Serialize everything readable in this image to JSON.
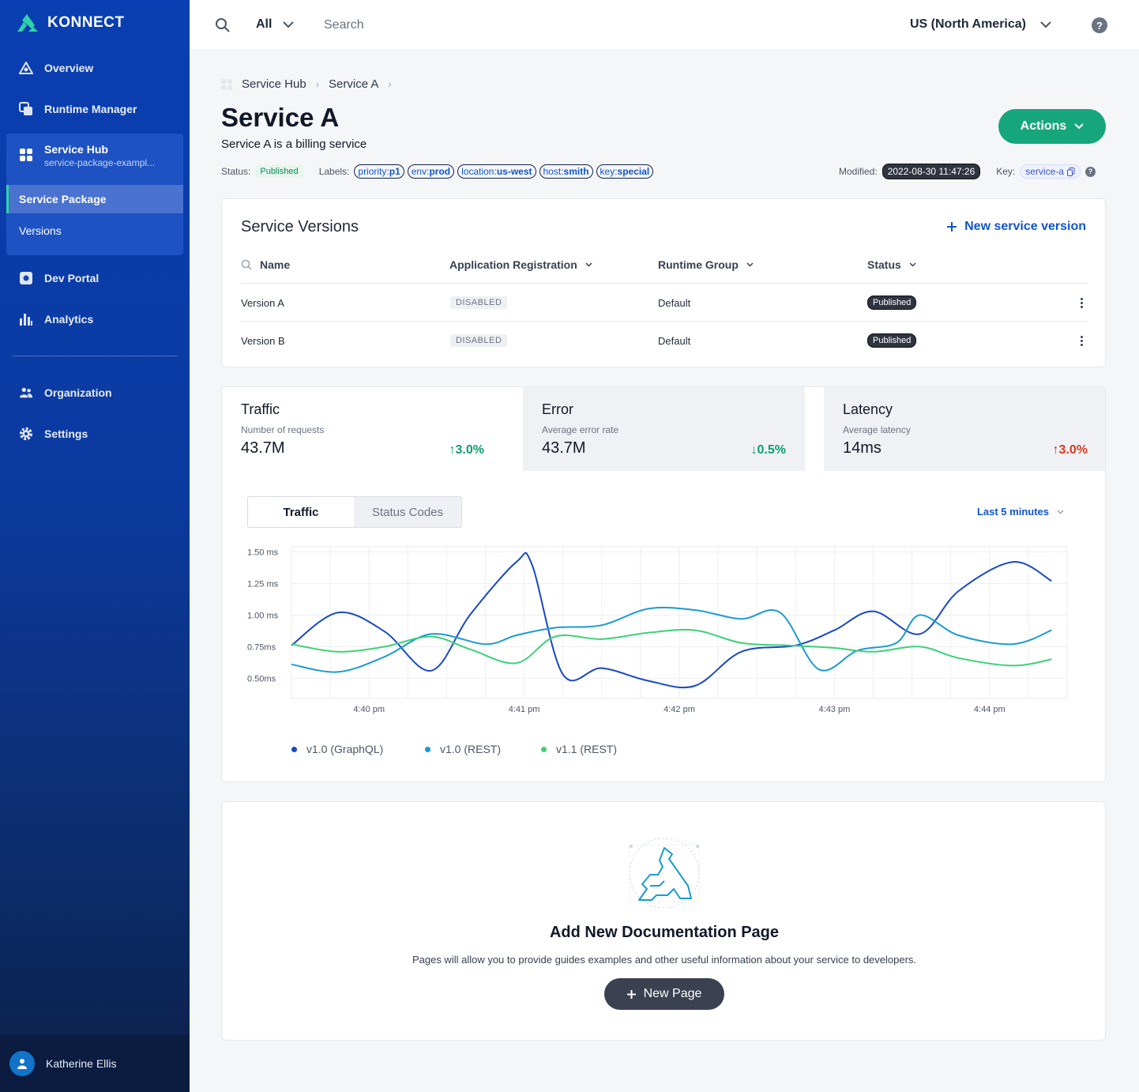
{
  "brand": {
    "name": "KONNECT"
  },
  "sidebar": {
    "items": [
      {
        "label": "Overview",
        "icon": "overview-icon"
      },
      {
        "label": "Runtime Manager",
        "icon": "runtime-manager-icon"
      },
      {
        "label": "Service Hub",
        "icon": "service-hub-icon",
        "subtitle": "service-package-exampl...",
        "children": [
          {
            "label": "Service Package",
            "active": true
          },
          {
            "label": "Versions"
          }
        ]
      },
      {
        "label": "Dev Portal",
        "icon": "dev-portal-icon"
      },
      {
        "label": "Analytics",
        "icon": "analytics-icon"
      },
      {
        "label": "Organization",
        "icon": "organization-icon"
      },
      {
        "label": "Settings",
        "icon": "settings-icon"
      }
    ],
    "user": {
      "name": "Katherine Ellis"
    }
  },
  "topbar": {
    "scope": "All",
    "search_placeholder": "Search",
    "region": "US (North America)"
  },
  "breadcrumb": [
    "Service Hub",
    "Service A"
  ],
  "service": {
    "title": "Service A",
    "description": "Service A is a billing service",
    "status_label": "Status:",
    "status": "Published",
    "labels_label": "Labels:",
    "labels": [
      {
        "key": "priority:",
        "value": "p1"
      },
      {
        "key": "env:",
        "value": "prod"
      },
      {
        "key": "location:",
        "value": "us-west"
      },
      {
        "key": "host:",
        "value": "smith"
      },
      {
        "key": "key:",
        "value": "special"
      }
    ],
    "modified_label": "Modified:",
    "modified": "2022-08-30 11:47:26",
    "key_label": "Key:",
    "key": "service-a"
  },
  "actions_label": "Actions",
  "versions": {
    "title": "Service Versions",
    "new_label": "New service version",
    "columns": [
      "Name",
      "Application Registration",
      "Runtime Group",
      "Status"
    ],
    "rows": [
      {
        "name": "Version A",
        "registration": "DISABLED",
        "runtime_group": "Default",
        "status": "Published"
      },
      {
        "name": "Version B",
        "registration": "DISABLED",
        "runtime_group": "Default",
        "status": "Published"
      }
    ]
  },
  "metrics": [
    {
      "title": "Traffic",
      "subtitle": "Number of requests",
      "value": "43.7M",
      "delta": "3.0%",
      "direction": "up",
      "color": "#0e9f6e"
    },
    {
      "title": "Error",
      "subtitle": "Average error rate",
      "value": "43.7M",
      "delta": "0.5%",
      "direction": "down",
      "color": "#0e9f6e"
    },
    {
      "title": "Latency",
      "subtitle": "Average latency",
      "value": "14ms",
      "delta": "3.0%",
      "direction": "up",
      "color": "#d9391e"
    }
  ],
  "chart_tabs": [
    "Traffic",
    "Status Codes"
  ],
  "time_range": "Last 5 minutes",
  "chart_data": {
    "type": "line",
    "ytick_labels": [
      "1.50 ms",
      "1.25 ms",
      "1.00 ms",
      "0.75ms",
      "0.50ms"
    ],
    "yticks": [
      1.5,
      1.25,
      1.0,
      0.75,
      0.5
    ],
    "ylim": [
      0.34,
      1.54
    ],
    "xticks": [
      "4:40 pm",
      "4:41 pm",
      "4:42 pm",
      "4:43 pm",
      "4:44 pm"
    ],
    "xtick_positions": [
      1,
      3,
      5,
      7,
      9
    ],
    "xlim": [
      0,
      10
    ],
    "grid": true,
    "legend_position": "bottom-left",
    "series": [
      {
        "name": "v1.0 (GraphQL)",
        "color": "#1a48c4",
        "x": [
          0,
          0.6,
          1.2,
          1.8,
          2.3,
          2.9,
          3.1,
          3.5,
          4.0,
          4.6,
          5.2,
          5.8,
          6.5,
          7.0,
          7.5,
          8.1,
          8.6,
          9.3,
          9.8
        ],
        "y": [
          0.76,
          1.02,
          0.87,
          0.56,
          1.0,
          1.42,
          1.4,
          0.53,
          0.58,
          0.48,
          0.44,
          0.71,
          0.76,
          0.88,
          1.03,
          0.85,
          1.19,
          1.42,
          1.27
        ]
      },
      {
        "name": "v1.0 (REST)",
        "color": "#1a9bd0",
        "x": [
          0,
          0.6,
          1.2,
          1.8,
          2.5,
          2.9,
          3.4,
          4.0,
          4.6,
          5.2,
          5.8,
          6.3,
          6.8,
          7.3,
          7.8,
          8.1,
          8.6,
          9.3,
          9.8
        ],
        "y": [
          0.61,
          0.55,
          0.67,
          0.85,
          0.77,
          0.84,
          0.9,
          0.92,
          1.05,
          1.04,
          0.97,
          1.02,
          0.57,
          0.72,
          0.78,
          1.0,
          0.84,
          0.77,
          0.88
        ]
      },
      {
        "name": "v1.1 (REST)",
        "color": "#3dd179",
        "x": [
          0,
          0.6,
          1.2,
          1.8,
          2.3,
          2.9,
          3.4,
          4.0,
          4.6,
          5.2,
          5.8,
          6.4,
          7.0,
          7.5,
          8.1,
          8.6,
          9.3,
          9.8
        ],
        "y": [
          0.77,
          0.71,
          0.75,
          0.83,
          0.73,
          0.62,
          0.83,
          0.81,
          0.86,
          0.88,
          0.78,
          0.76,
          0.74,
          0.71,
          0.75,
          0.66,
          0.6,
          0.65
        ]
      }
    ]
  },
  "docs": {
    "title": "Add New Documentation Page",
    "description": "Pages will allow you to provide guides examples and other useful information about your service to developers.",
    "button": "New Page"
  }
}
